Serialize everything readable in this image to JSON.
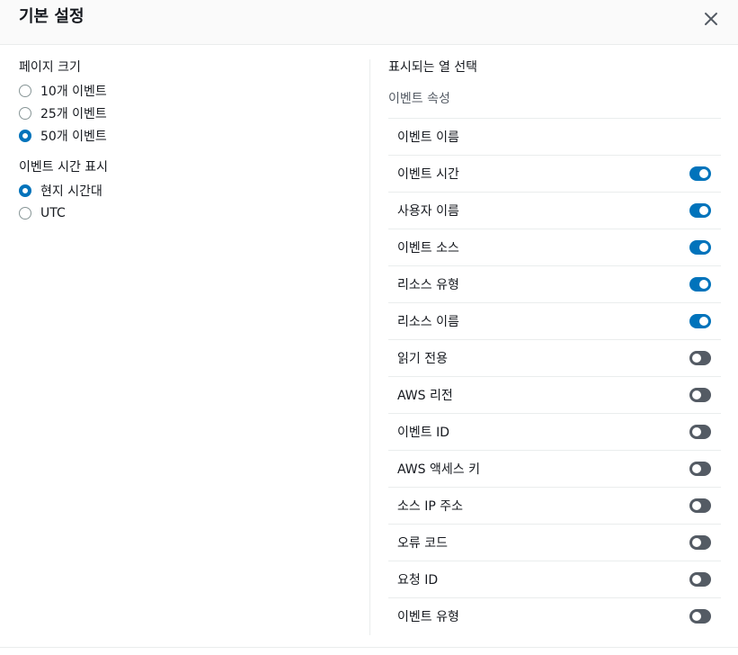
{
  "modal": {
    "title": "기본 설정",
    "close_icon": "close-icon"
  },
  "page_size": {
    "label": "페이지 크기",
    "options": [
      {
        "label": "10개 이벤트",
        "checked": false
      },
      {
        "label": "25개 이벤트",
        "checked": false
      },
      {
        "label": "50개 이벤트",
        "checked": true
      }
    ]
  },
  "time_display": {
    "label": "이벤트 시간 표시",
    "options": [
      {
        "label": "현지 시간대",
        "checked": true
      },
      {
        "label": "UTC",
        "checked": false
      }
    ]
  },
  "columns": {
    "title": "표시되는 열 선택",
    "group_label": "이벤트 속성",
    "items": [
      {
        "label": "이벤트 이름",
        "toggle": null
      },
      {
        "label": "이벤트 시간",
        "toggle": true
      },
      {
        "label": "사용자 이름",
        "toggle": true
      },
      {
        "label": "이벤트 소스",
        "toggle": true
      },
      {
        "label": "리소스 유형",
        "toggle": true
      },
      {
        "label": "리소스 이름",
        "toggle": true
      },
      {
        "label": "읽기 전용",
        "toggle": false
      },
      {
        "label": "AWS 리전",
        "toggle": false
      },
      {
        "label": "이벤트 ID",
        "toggle": false
      },
      {
        "label": "AWS 액세스 키",
        "toggle": false
      },
      {
        "label": "소스 IP 주소",
        "toggle": false
      },
      {
        "label": "오류 코드",
        "toggle": false
      },
      {
        "label": "요청 ID",
        "toggle": false
      },
      {
        "label": "이벤트 유형",
        "toggle": false
      }
    ]
  },
  "colors": {
    "accent": "#0073bb",
    "toggle_off": "#545b64",
    "border": "#eaeded"
  }
}
